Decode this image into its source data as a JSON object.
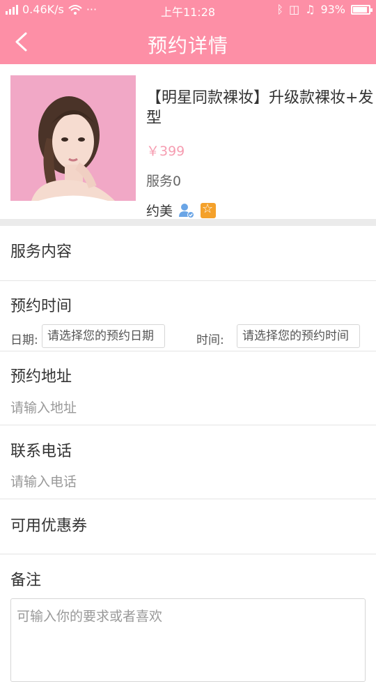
{
  "status_bar": {
    "network": "0.46K/s",
    "time": "上午11:28",
    "battery": "93%"
  },
  "nav": {
    "title": "预约详情"
  },
  "product": {
    "title": "【明星同款裸妆】升级款裸妆+发型",
    "price": "￥399",
    "service": "服务0",
    "vendor": "约美"
  },
  "sections": {
    "service_content": "服务内容",
    "appointment_time": "预约时间",
    "date_label": "日期:",
    "date_placeholder": "请选择您的预约日期",
    "time_label": "时间:",
    "time_placeholder": "请选择您的预约时间",
    "address_label": "预约地址",
    "address_placeholder": "请输入地址",
    "phone_label": "联系电话",
    "phone_placeholder": "请输入电话",
    "coupon_label": "可用优惠券",
    "remark_label": "备注",
    "remark_placeholder": "可输入你的要求或者喜欢"
  },
  "colors": {
    "header": "#fd8fa6",
    "price": "#f69db1"
  }
}
